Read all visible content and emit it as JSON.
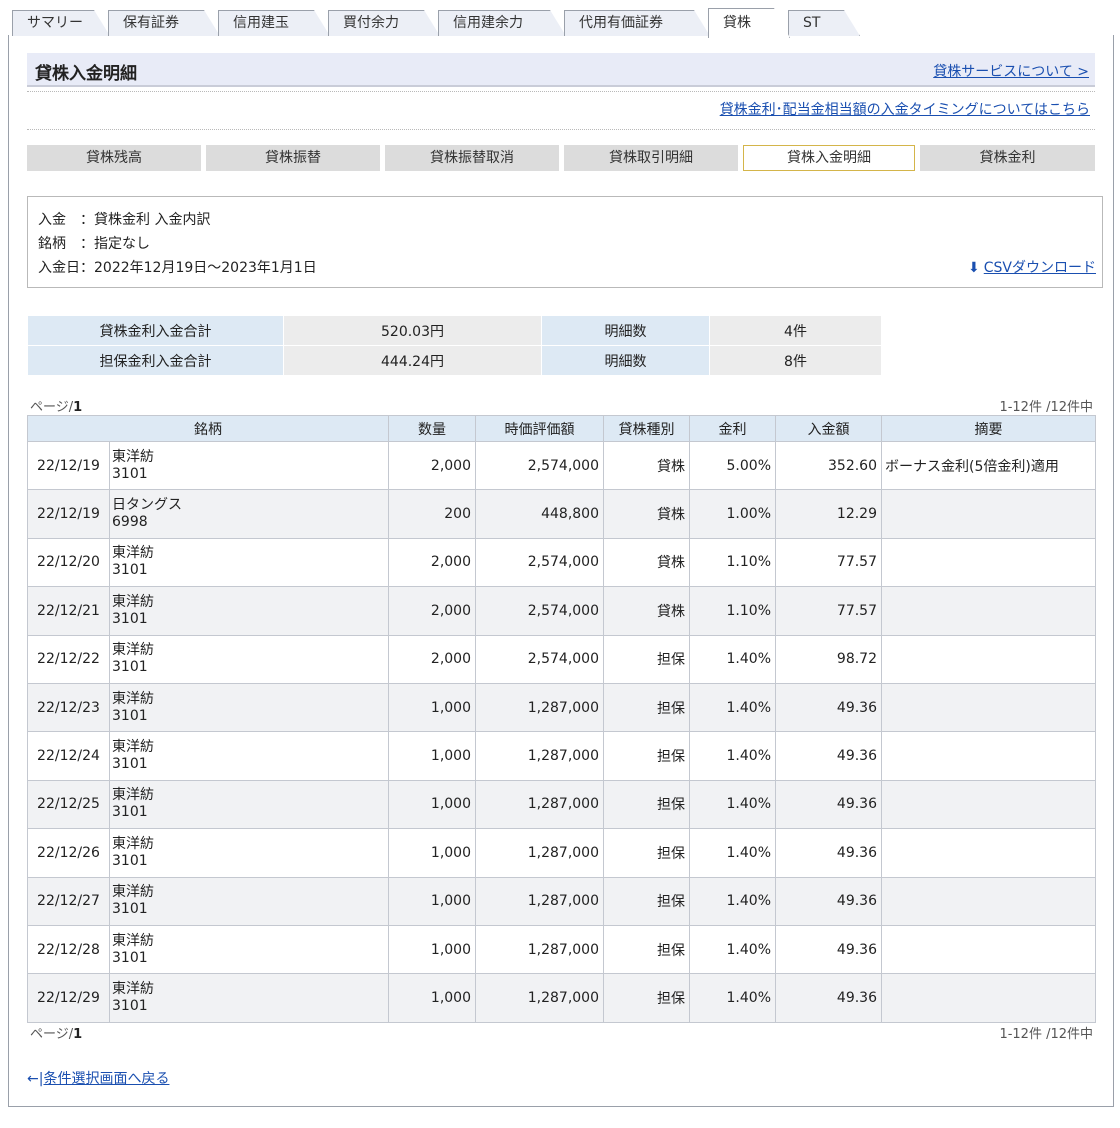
{
  "tabs": [
    "サマリー",
    "保有証券",
    "信用建玉",
    "買付余力",
    "信用建余力",
    "代用有価証券",
    "貸株",
    "ST"
  ],
  "header": {
    "title": "貸株入金明細",
    "service_link": "貸株サービスについて >",
    "timing_link": "貸株金利･配当金相当額の入金タイミングについてはこちら"
  },
  "subnav": [
    "貸株残高",
    "貸株振替",
    "貸株振替取消",
    "貸株取引明細",
    "貸株入金明細",
    "貸株金利"
  ],
  "conditions": {
    "deposit": "入金　：貸株金利 入金内訳",
    "stock": "銘柄　：指定なし",
    "date": "入金日：2022年12月19日～2023年1月1日",
    "csv": "CSVダウンロード",
    "csv_icon": "⬇"
  },
  "summary": [
    {
      "label": "貸株金利入金合計",
      "value": "520.03円",
      "count_label": "明細数",
      "count": "4件"
    },
    {
      "label": "担保金利入金合計",
      "value": "444.24円",
      "count_label": "明細数",
      "count": "8件"
    }
  ],
  "paging": {
    "page_prefix": "ページ/",
    "page": "1",
    "range": "1-12件 /12件中"
  },
  "table": {
    "headers": [
      "銘柄",
      "数量",
      "時価評価額",
      "貸株種別",
      "金利",
      "入金額",
      "摘要"
    ],
    "rows": [
      {
        "date": "22/12/19",
        "name": "東洋紡",
        "code": "3101",
        "qty": "2,000",
        "value": "2,574,000",
        "type": "貸株",
        "rate": "5.00%",
        "amount": "352.60",
        "note": "ボーナス金利(5倍金利)適用"
      },
      {
        "date": "22/12/19",
        "name": "日タングス",
        "code": "6998",
        "qty": "200",
        "value": "448,800",
        "type": "貸株",
        "rate": "1.00%",
        "amount": "12.29",
        "note": ""
      },
      {
        "date": "22/12/20",
        "name": "東洋紡",
        "code": "3101",
        "qty": "2,000",
        "value": "2,574,000",
        "type": "貸株",
        "rate": "1.10%",
        "amount": "77.57",
        "note": ""
      },
      {
        "date": "22/12/21",
        "name": "東洋紡",
        "code": "3101",
        "qty": "2,000",
        "value": "2,574,000",
        "type": "貸株",
        "rate": "1.10%",
        "amount": "77.57",
        "note": ""
      },
      {
        "date": "22/12/22",
        "name": "東洋紡",
        "code": "3101",
        "qty": "2,000",
        "value": "2,574,000",
        "type": "担保",
        "rate": "1.40%",
        "amount": "98.72",
        "note": ""
      },
      {
        "date": "22/12/23",
        "name": "東洋紡",
        "code": "3101",
        "qty": "1,000",
        "value": "1,287,000",
        "type": "担保",
        "rate": "1.40%",
        "amount": "49.36",
        "note": ""
      },
      {
        "date": "22/12/24",
        "name": "東洋紡",
        "code": "3101",
        "qty": "1,000",
        "value": "1,287,000",
        "type": "担保",
        "rate": "1.40%",
        "amount": "49.36",
        "note": ""
      },
      {
        "date": "22/12/25",
        "name": "東洋紡",
        "code": "3101",
        "qty": "1,000",
        "value": "1,287,000",
        "type": "担保",
        "rate": "1.40%",
        "amount": "49.36",
        "note": ""
      },
      {
        "date": "22/12/26",
        "name": "東洋紡",
        "code": "3101",
        "qty": "1,000",
        "value": "1,287,000",
        "type": "担保",
        "rate": "1.40%",
        "amount": "49.36",
        "note": ""
      },
      {
        "date": "22/12/27",
        "name": "東洋紡",
        "code": "3101",
        "qty": "1,000",
        "value": "1,287,000",
        "type": "担保",
        "rate": "1.40%",
        "amount": "49.36",
        "note": ""
      },
      {
        "date": "22/12/28",
        "name": "東洋紡",
        "code": "3101",
        "qty": "1,000",
        "value": "1,287,000",
        "type": "担保",
        "rate": "1.40%",
        "amount": "49.36",
        "note": ""
      },
      {
        "date": "22/12/29",
        "name": "東洋紡",
        "code": "3101",
        "qty": "1,000",
        "value": "1,287,000",
        "type": "担保",
        "rate": "1.40%",
        "amount": "49.36",
        "note": ""
      }
    ]
  },
  "back": {
    "icon": "←|",
    "label": "条件選択画面へ戻る"
  }
}
